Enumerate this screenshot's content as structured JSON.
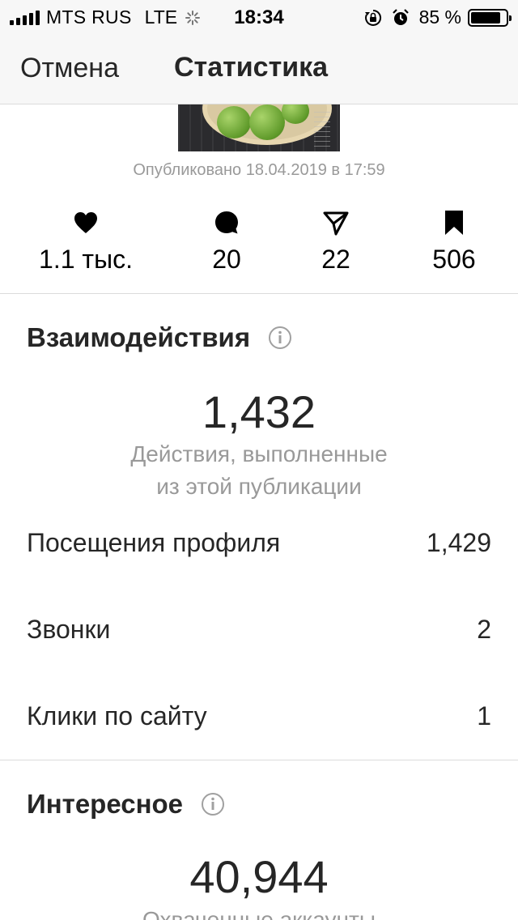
{
  "status_bar": {
    "carrier": "MTS RUS",
    "network": "LTE",
    "time": "18:34",
    "battery_percent": "85 %",
    "battery_level": 0.85,
    "icons": [
      "signal-icon",
      "loading-icon",
      "orientation-lock-icon",
      "alarm-icon",
      "battery-icon"
    ]
  },
  "nav": {
    "cancel_label": "Отмена",
    "title": "Статистика"
  },
  "post": {
    "published": "Опубликовано 18.04.2019 в 17:59"
  },
  "metrics": [
    {
      "icon": "heart-icon",
      "value": "1.1 тыс."
    },
    {
      "icon": "comment-icon",
      "value": "20"
    },
    {
      "icon": "share-icon",
      "value": "22"
    },
    {
      "icon": "bookmark-icon",
      "value": "506"
    }
  ],
  "interactions": {
    "title": "Взаимодействия",
    "total": "1,432",
    "caption_line1": "Действия, выполненные",
    "caption_line2": "из этой публикации",
    "rows": [
      {
        "label": "Посещения профиля",
        "value": "1,429"
      },
      {
        "label": "Звонки",
        "value": "2"
      },
      {
        "label": "Клики по сайту",
        "value": "1"
      }
    ]
  },
  "discovery": {
    "title": "Интересное",
    "total": "40,944",
    "caption_line1": "Охваченные аккаунты"
  },
  "colors": {
    "text": "#262626",
    "secondary": "#999999",
    "divider": "#dbdbdb",
    "bar_background": "#f7f7f7"
  }
}
